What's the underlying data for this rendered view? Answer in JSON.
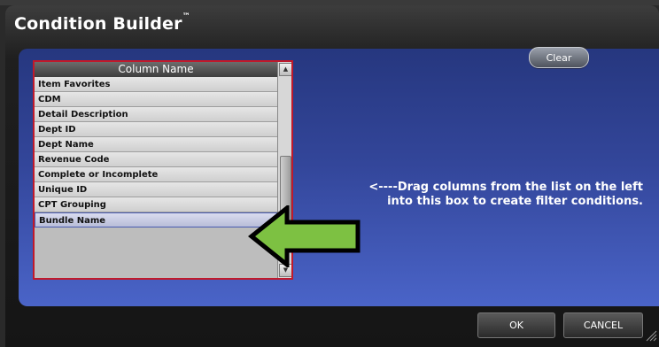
{
  "dialog": {
    "title": "Condition Builder",
    "title_mark": "™"
  },
  "clear_button": {
    "label": "Clear"
  },
  "column_list": {
    "header": "Column Name",
    "items": [
      "Item Favorites",
      "CDM",
      "Detail Description",
      "Dept ID",
      "Dept Name",
      "Revenue Code",
      "Complete or Incomplete",
      "Unique ID",
      "CPT Grouping",
      "Bundle Name"
    ],
    "selected": "Bundle Name"
  },
  "instruction": {
    "line1": "<----Drag columns from the list on the left",
    "line2": "into this box to create filter conditions."
  },
  "buttons": {
    "ok": "OK",
    "cancel": "CANCEL"
  },
  "colors": {
    "arrow_fill": "#7dc142",
    "list_border": "#c0192b",
    "panel_blue": "#3a50b0"
  }
}
